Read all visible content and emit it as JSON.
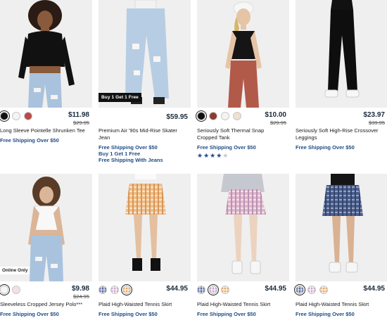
{
  "products": [
    {
      "title": "Long Sleeve Pointelle Shrunken Tee",
      "price": "$11.98",
      "was": "$29.95",
      "promos": [
        "Free Shipping Over $50"
      ],
      "swatches": [
        "black",
        "white",
        "red"
      ],
      "colors": {
        "black": "#111111",
        "white": "#f4f4f4",
        "red": "#b94a4a"
      }
    },
    {
      "title": "Premium Air '90s Mid-Rise Skater Jean",
      "price": "$59.95",
      "was": "",
      "badge": "Buy 1 Get 1 Free",
      "promos": [
        "Free Shipping Over $50",
        "Buy 1 Get 1 Free",
        "Free Shipping With Jeans"
      ],
      "swatches": []
    },
    {
      "title": "Seriously Soft Thermal Snap Cropped Tank",
      "price": "$10.00",
      "was": "$29.95",
      "promos": [
        "Free Shipping Over $50"
      ],
      "swatches": [
        "black",
        "brick",
        "white",
        "cream"
      ],
      "rating": 4,
      "rating_max": 5
    },
    {
      "title": "Seriously Soft High-Rise Crossover Leggings",
      "price": "$23.97",
      "was": "$39.95",
      "promos": [
        "Free Shipping Over $50"
      ],
      "swatches": []
    },
    {
      "title": "Sleeveless Cropped Jersey Polo***",
      "price": "$9.98",
      "was": "$24.95",
      "badge_online": "Online Only",
      "promos": [
        "Free Shipping Over $50"
      ],
      "swatches": [
        "white",
        "pink"
      ]
    },
    {
      "title": "Plaid High-Waisted Tennis Skirt",
      "price": "$44.95",
      "was": "",
      "promos": [
        "Free Shipping Over $50"
      ],
      "swatches": [
        "plaid-blue",
        "plaid-pink",
        "plaid-orange"
      ]
    },
    {
      "title": "Plaid High-Waisted Tennis Skirt",
      "price": "$44.95",
      "was": "",
      "promos": [
        "Free Shipping Over $50"
      ],
      "swatches": [
        "plaid-blue",
        "plaid-pink",
        "plaid-orange"
      ]
    },
    {
      "title": "Plaid High-Waisted Tennis Skirt",
      "price": "$44.95",
      "was": "",
      "promos": [
        "Free Shipping Over $50"
      ],
      "swatches": [
        "plaid-blue",
        "plaid-pink",
        "plaid-orange"
      ]
    }
  ],
  "colors": {
    "promo": "#1f4d84",
    "price": "#1a2a3a"
  }
}
